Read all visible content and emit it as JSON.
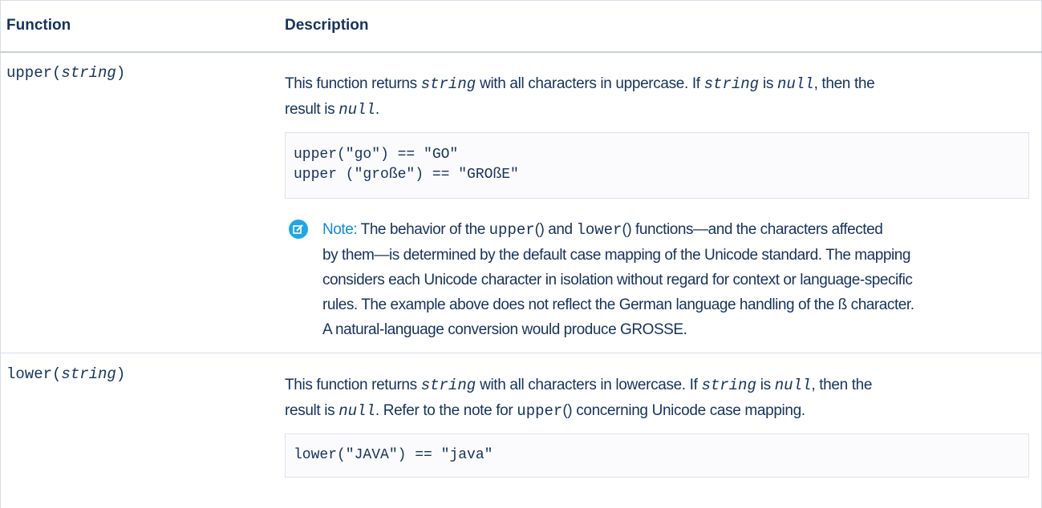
{
  "header": {
    "col_function": "Function",
    "col_description": "Description"
  },
  "rows": [
    {
      "function_name": "upper(",
      "function_param": "string",
      "function_close": ")",
      "desc": {
        "t1": "This function returns ",
        "c1": "string",
        "t2": " with all characters in uppercase. If ",
        "c2": "string",
        "t3": " is ",
        "c3": "null",
        "t4": ", then the",
        "t5": "result is ",
        "c4": "null",
        "t6": "."
      },
      "code": [
        "upper(\"go\") == \"GO\"",
        "upper (\"große\") == \"GROßE\""
      ],
      "note": {
        "label": "Note:",
        "p1": " The behavior of the ",
        "code1": "upper",
        "p2": "() and ",
        "code2": "lower",
        "p3": "() functions—and the characters affected",
        "line2": "by them—is determined by the default case mapping of the Unicode standard. The mapping",
        "line3": "considers each Unicode character in isolation without regard for context or language-specific",
        "line4": "rules. The example above does not reflect the German language handling of the ß character.",
        "line5": "A natural-language conversion would produce GROSSE."
      }
    },
    {
      "function_name": "lower(",
      "function_param": "string",
      "function_close": ")",
      "desc": {
        "t1": "This function returns ",
        "c1": "string",
        "t2": " with all characters in lowercase. If ",
        "c2": "string",
        "t3": " is ",
        "c3": "null",
        "t4": ", then the",
        "t5": "result is ",
        "c4": "null",
        "t6": ". Refer to the note for ",
        "c5": "upper",
        "t7": "() concerning Unicode case mapping."
      },
      "code": [
        "lower(\"JAVA\") == \"java\""
      ]
    }
  ],
  "icons": {
    "note": "edit-note-icon"
  },
  "colors": {
    "text": "#16325c",
    "accent": "#0d8ad6",
    "icon_bg": "#1fa7e5",
    "border": "#d8dde6"
  }
}
